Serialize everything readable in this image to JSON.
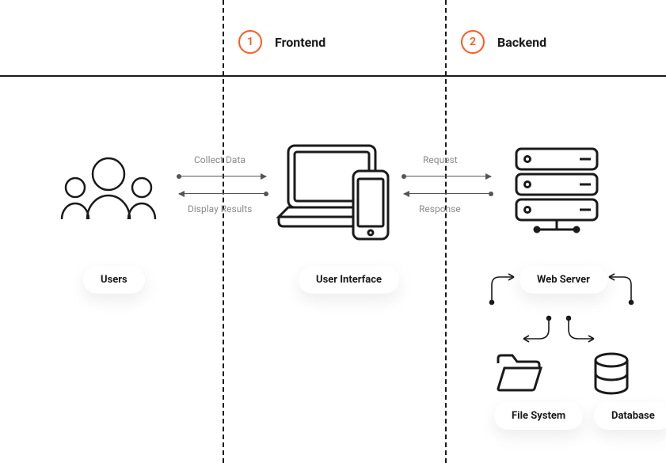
{
  "sections": {
    "frontend": {
      "num": "1",
      "title": "Frontend"
    },
    "backend": {
      "num": "2",
      "title": "Backend"
    }
  },
  "nodes": {
    "users": "Users",
    "ui": "User Interface",
    "webserver": "Web Server",
    "filesystem": "File System",
    "database": "Database"
  },
  "flows": {
    "collect": "Collect Data",
    "display": "Display Results",
    "request": "Request",
    "response": "Response"
  }
}
